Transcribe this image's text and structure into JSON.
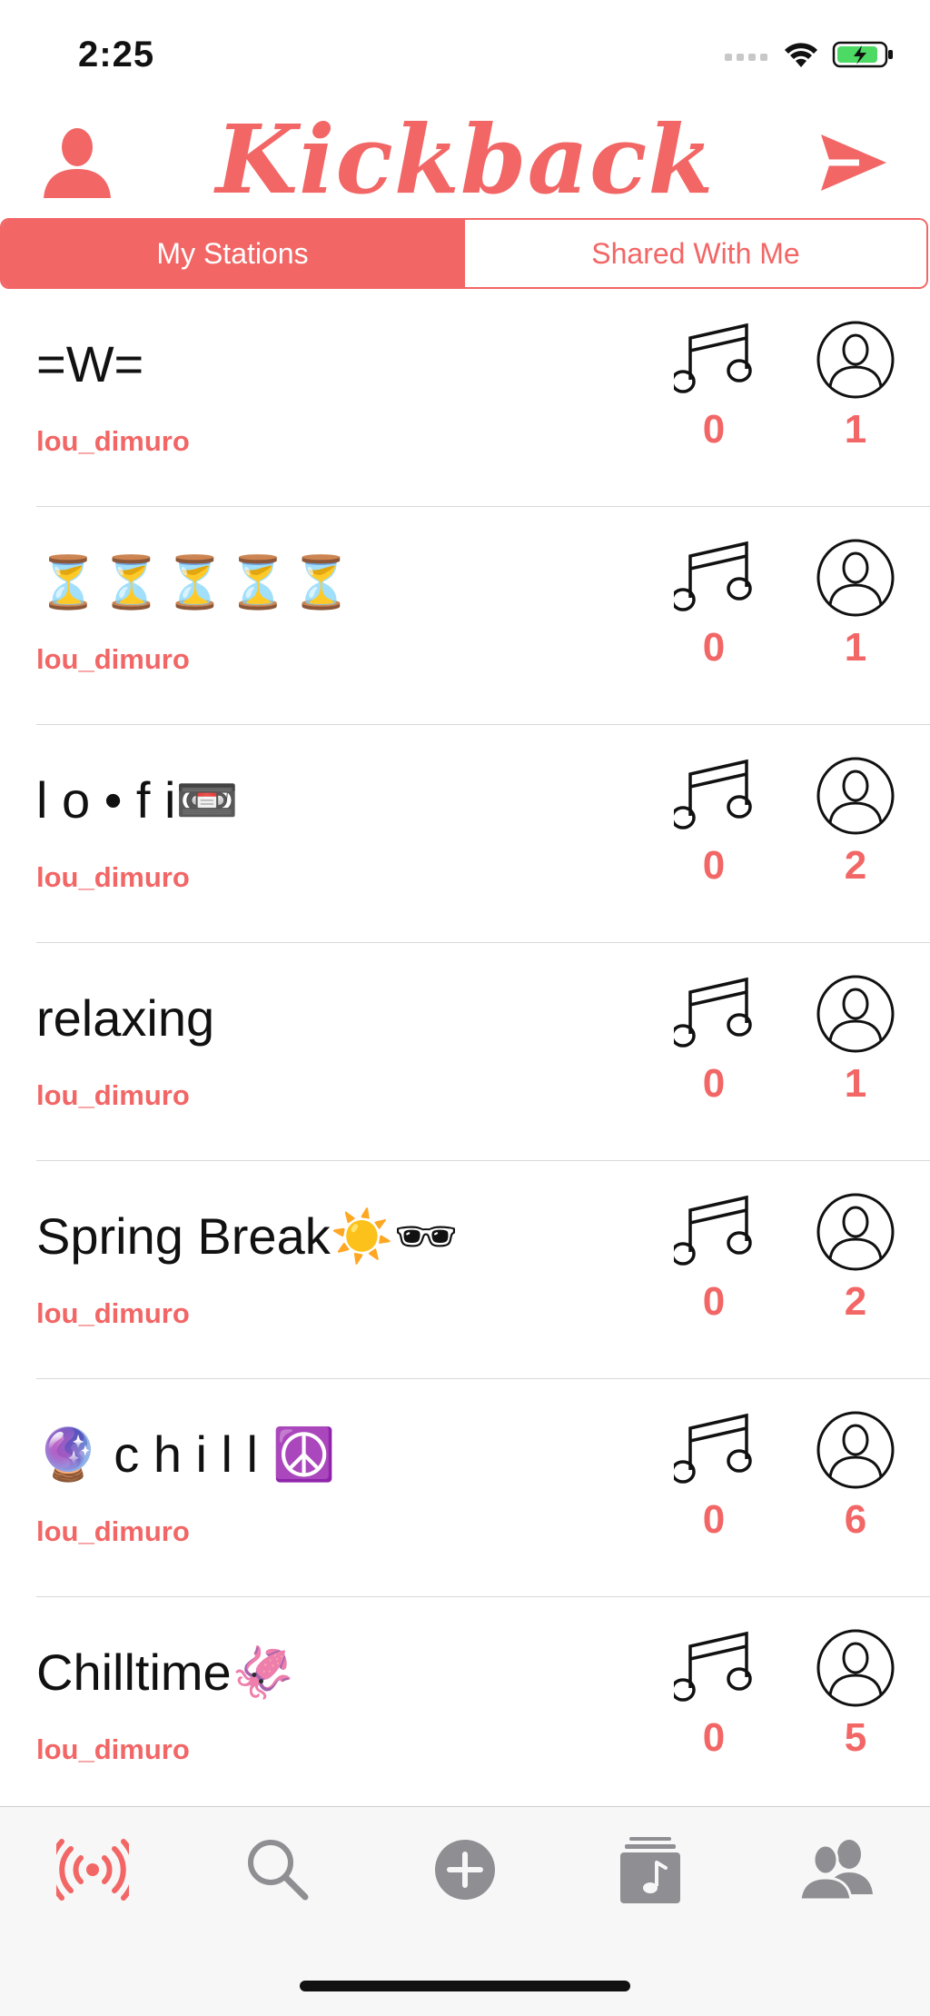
{
  "status_bar": {
    "time": "2:25"
  },
  "header": {
    "brand": "Kickback",
    "profile_icon": "person-icon",
    "send_icon": "send-arrow-icon",
    "accent_color": "#F26666"
  },
  "segments": [
    {
      "label": "My Stations",
      "active": true
    },
    {
      "label": "Shared With Me",
      "active": false
    }
  ],
  "stations": [
    {
      "name": "=W=",
      "owner": "lou_dimuro",
      "songs": "0",
      "listeners": "1"
    },
    {
      "name": "⏳⏳⏳⏳⏳",
      "owner": "lou_dimuro",
      "songs": "0",
      "listeners": "1"
    },
    {
      "name": "l o • f i📼",
      "owner": "lou_dimuro",
      "songs": "0",
      "listeners": "2"
    },
    {
      "name": "relaxing",
      "owner": "lou_dimuro",
      "songs": "0",
      "listeners": "1"
    },
    {
      "name": "Spring Break☀️🕶",
      "owner": "lou_dimuro",
      "songs": "0",
      "listeners": "2"
    },
    {
      "name": "🔮 c h i l l ☮️",
      "owner": "lou_dimuro",
      "songs": "0",
      "listeners": "6"
    },
    {
      "name": "Chilltime🦑",
      "owner": "lou_dimuro",
      "songs": "0",
      "listeners": "5"
    }
  ],
  "tab_bar": {
    "tabs": [
      {
        "icon": "broadcast-icon",
        "active": true
      },
      {
        "icon": "search-icon",
        "active": false
      },
      {
        "icon": "add-circle-icon",
        "active": false
      },
      {
        "icon": "music-library-icon",
        "active": false
      },
      {
        "icon": "friends-icon",
        "active": false
      }
    ]
  }
}
